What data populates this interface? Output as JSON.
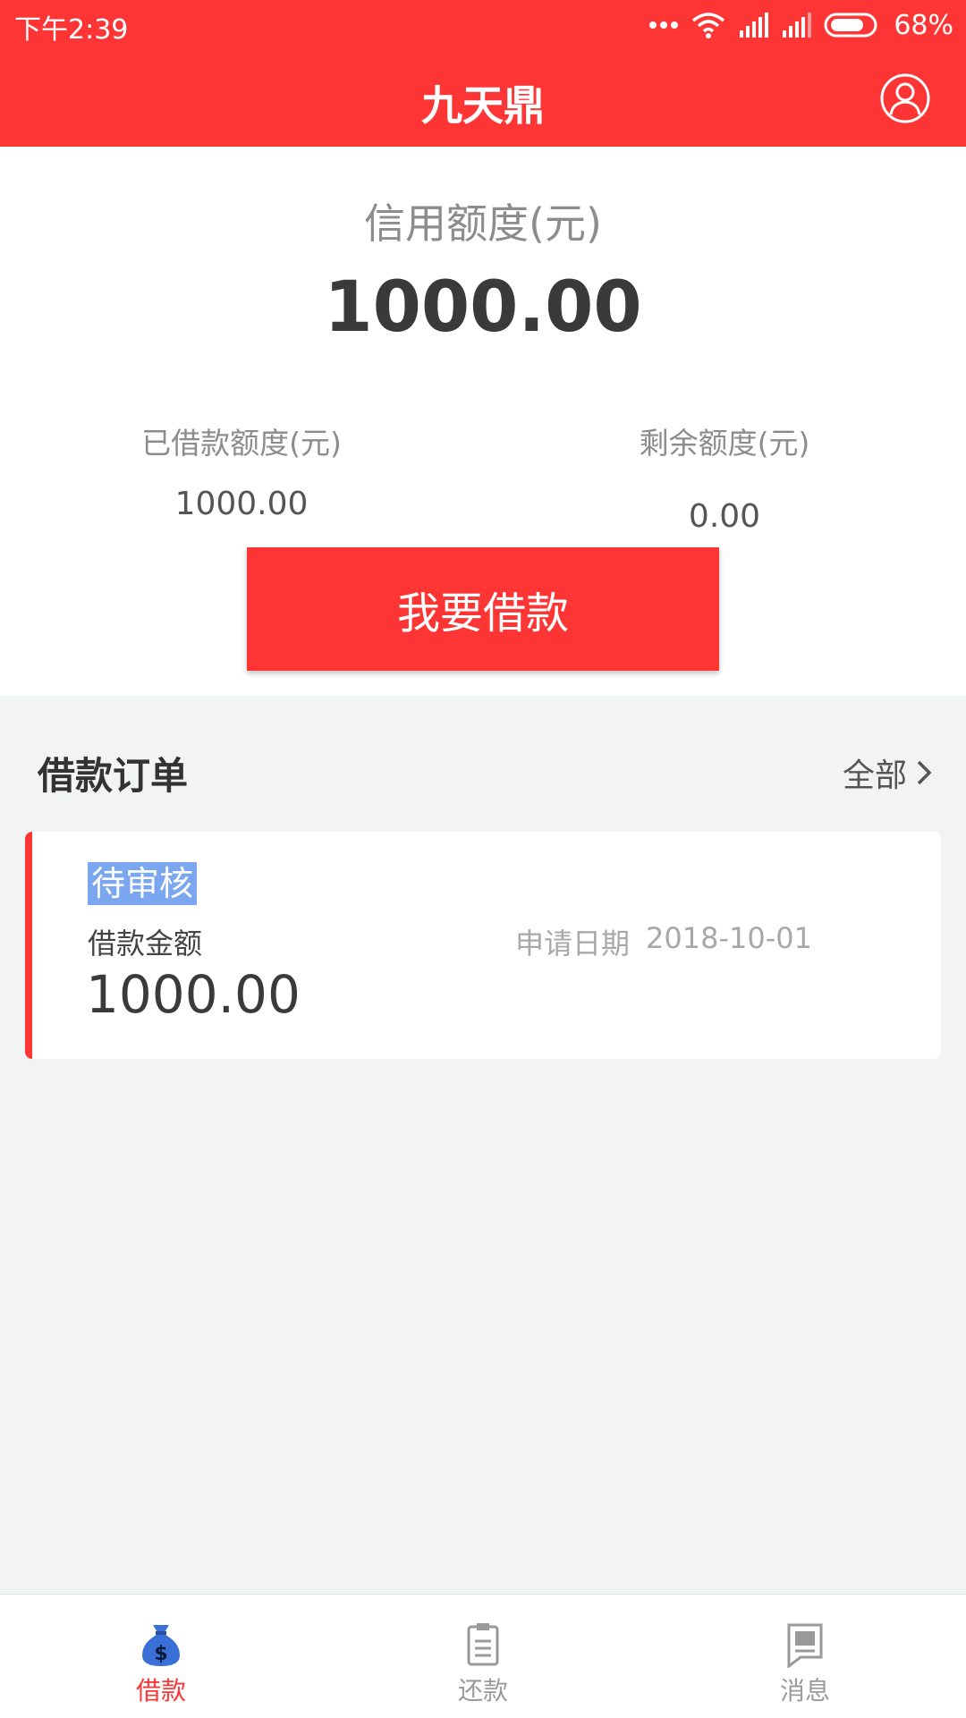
{
  "status_bar": {
    "time": "下午2:39",
    "battery": "68%"
  },
  "header": {
    "title": "九天鼎"
  },
  "credit": {
    "label": "信用额度(元)",
    "value": "1000.00",
    "borrowed_label": "已借款额度(元)",
    "borrowed_value": "1000.00",
    "remaining_label": "剩余额度(元)",
    "remaining_value": "0.00",
    "borrow_button": "我要借款"
  },
  "orders": {
    "title": "借款订单",
    "all_label": "全部",
    "items": [
      {
        "status": "待审核",
        "amount_label": "借款金额",
        "amount": "1000.00",
        "date_label": "申请日期",
        "date": "2018-10-01"
      }
    ]
  },
  "tabs": [
    {
      "label": "借款",
      "icon": "money-bag-icon",
      "active": true
    },
    {
      "label": "还款",
      "icon": "clipboard-icon",
      "active": false
    },
    {
      "label": "消息",
      "icon": "message-icon",
      "active": false
    }
  ],
  "colors": {
    "brand_red": "#fe3535",
    "background": "#f2f3f3",
    "selection_blue": "#7aa7f0"
  }
}
